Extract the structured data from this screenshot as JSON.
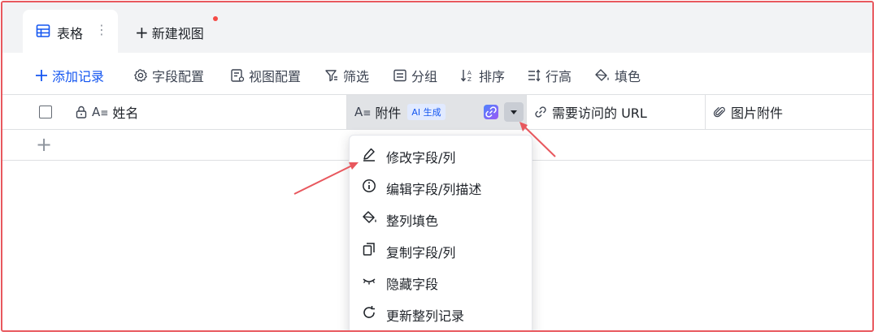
{
  "tabs": {
    "active_label": "表格",
    "new_view_label": "新建视图"
  },
  "toolbar": {
    "add_record": "添加记录",
    "field_config": "字段配置",
    "view_config": "视图配置",
    "filter": "筛选",
    "group": "分组",
    "sort": "排序",
    "row_height": "行高",
    "fill_color": "填色"
  },
  "columns": {
    "name": "姓名",
    "attachment": "附件",
    "ai_badge": "AI 生成",
    "url": "需要访问的 URL",
    "image_attachment": "图片附件"
  },
  "menu": {
    "items": [
      {
        "label": "修改字段/列",
        "icon": "pencil-icon"
      },
      {
        "label": "编辑字段/列描述",
        "icon": "info-icon"
      },
      {
        "label": "整列填色",
        "icon": "paint-bucket-icon"
      },
      {
        "label": "复制字段/列",
        "icon": "copy-icon"
      },
      {
        "label": "隐藏字段",
        "icon": "eye-closed-icon"
      },
      {
        "label": "更新整列记录",
        "icon": "refresh-icon"
      }
    ]
  },
  "colors": {
    "accent": "#1456f0",
    "annotation": "#e8585e"
  }
}
